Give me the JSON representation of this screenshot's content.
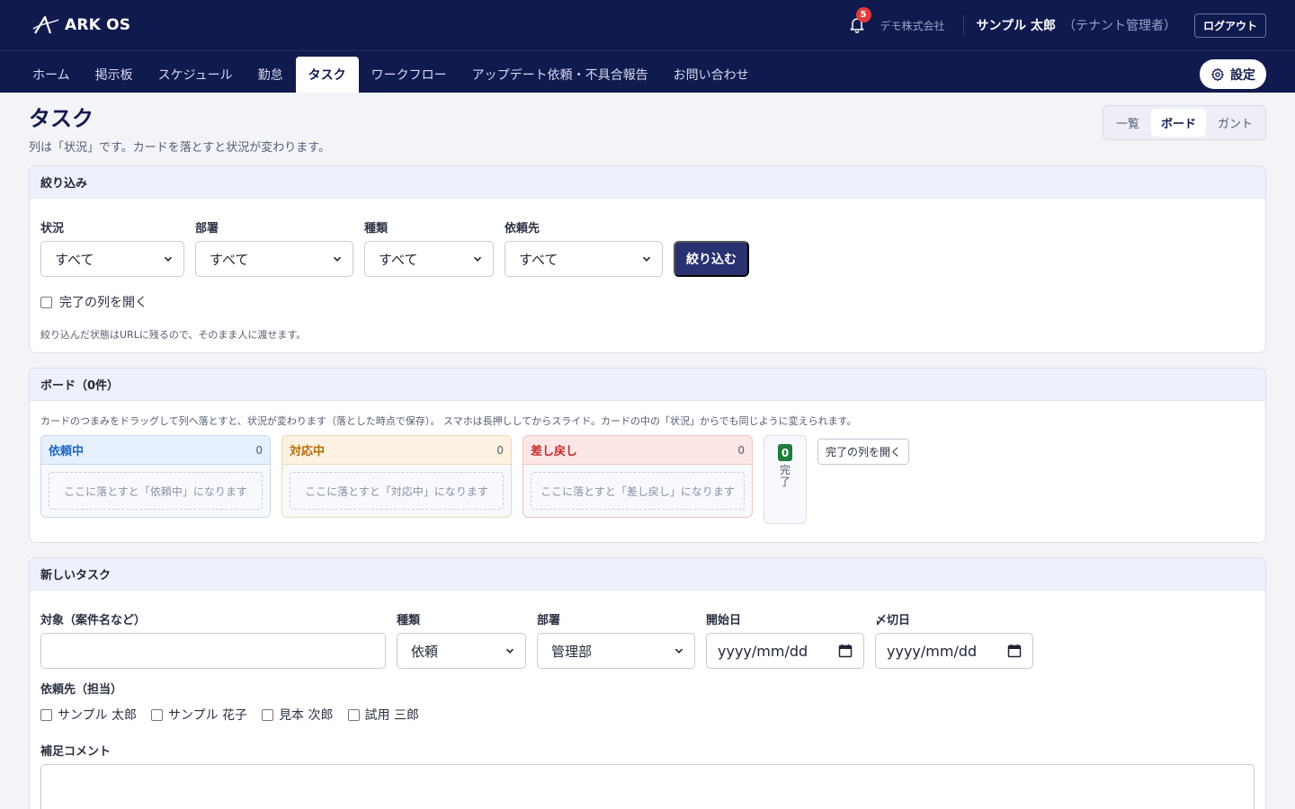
{
  "header": {
    "app_name": "ARK OS",
    "notification_count": "5",
    "company": "デモ株式会社",
    "user_name": "サンプル 太郎",
    "user_role": "（テナント管理者）",
    "logout_label": "ログアウト"
  },
  "nav": {
    "items": [
      "ホーム",
      "掲示板",
      "スケジュール",
      "勤怠",
      "タスク",
      "ワークフロー",
      "アップデート依頼・不具合報告",
      "お問い合わせ"
    ],
    "active": "タスク",
    "settings_label": "設定"
  },
  "page": {
    "title": "タスク",
    "description": "列は「状況」です。カードを落とすと状況が変わります。",
    "views": [
      "一覧",
      "ボード",
      "ガント"
    ],
    "active_view": "ボード"
  },
  "filter": {
    "title": "絞り込み",
    "fields": [
      {
        "label": "状況",
        "value": "すべて"
      },
      {
        "label": "部署",
        "value": "すべて"
      },
      {
        "label": "種類",
        "value": "すべて"
      },
      {
        "label": "依頼先",
        "value": "すべて"
      }
    ],
    "submit_label": "絞り込む",
    "open_done_label": "完了の列を開く",
    "hint": "絞り込んだ状態はURLに残るので、そのまま人に渡せます。"
  },
  "board": {
    "title": "ボード（0件）",
    "hint": "カードのつまみをドラッグして列へ落とすと、状況が変わります（落とした時点で保存）。 スマホは長押ししてからスライド。カードの中の「状況」からでも同じように変えられます。",
    "columns": [
      {
        "name": "依頼中",
        "count": "0",
        "drop_text": "ここに落とすと「依頼中」になります",
        "color": "#1f66c1"
      },
      {
        "name": "対応中",
        "count": "0",
        "drop_text": "ここに落とすと「対応中」になります",
        "color": "#b86a0a"
      },
      {
        "name": "差し戻し",
        "count": "0",
        "drop_text": "ここに落とすと「差し戻し」になります",
        "color": "#c62828"
      }
    ],
    "done": {
      "count": "0",
      "label": "完了",
      "color": "#1e7d3c"
    },
    "open_done_button": "完了の列を開く"
  },
  "new_task": {
    "title": "新しいタスク",
    "target_label": "対象（案件名など）",
    "target_value": "",
    "type_label": "種類",
    "type_value": "依頼",
    "dept_label": "部署",
    "dept_value": "管理部",
    "start_label": "開始日",
    "start_placeholder": "yyyy/mm/dd",
    "due_label": "〆切日",
    "due_placeholder": "yyyy/mm/dd",
    "assignee_label": "依頼先（担当）",
    "assignees": [
      "サンプル 太郎",
      "サンプル 花子",
      "見本 次郎",
      "試用 三郎"
    ],
    "comment_label": "補足コメント"
  }
}
